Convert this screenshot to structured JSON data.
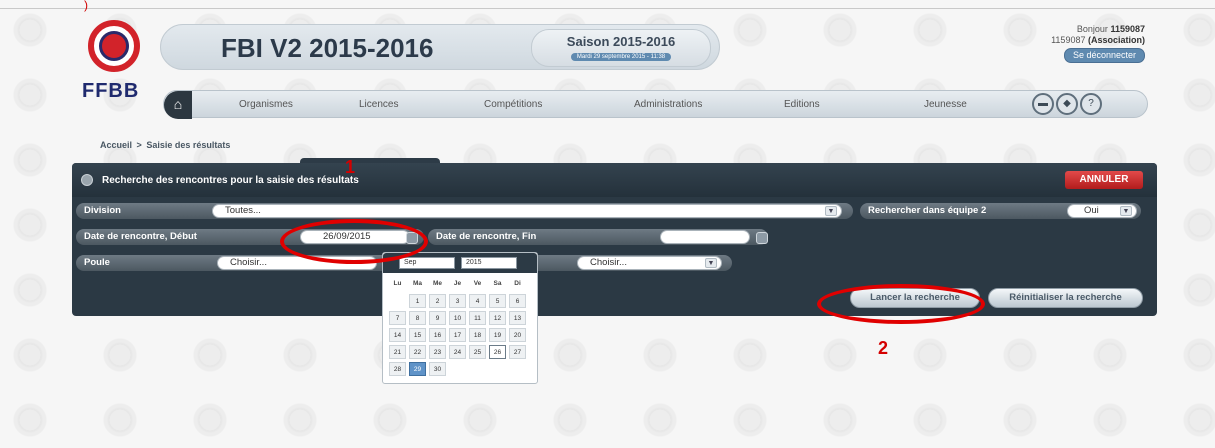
{
  "header": {
    "logo_text": "FFBB",
    "app_title": "FBI V2 2015-2016",
    "season_title": "Saison 2015-2016",
    "season_date": "Mardi 29 septembre 2015 - 11:38",
    "greeting_prefix": "Bonjour",
    "user_id": "1159087",
    "user_line_id": "1159087",
    "user_line_role": "(Association)",
    "logout_label": "Se déconnecter"
  },
  "nav": {
    "items": [
      "Organismes",
      "Licences",
      "Compétitions",
      "Administrations",
      "Editions",
      "Jeunesse"
    ],
    "icons": [
      "message-icon",
      "bookmark-icon",
      "help-icon"
    ],
    "help_glyph": "?"
  },
  "breadcrumb": {
    "home": "Accueil",
    "separator": ">",
    "current": "Saisie des résultats"
  },
  "panel": {
    "title": "Recherche des rencontres pour la saisie des résultats",
    "cancel_label": "ANNULER",
    "division_label": "Division",
    "division_value": "Toutes...",
    "search_team2_label": "Rechercher dans équipe 2",
    "search_team2_value": "Oui",
    "date_start_label": "Date de rencontre, Début",
    "date_start_value": "26/09/2015",
    "date_end_label": "Date de rencontre, Fin",
    "date_end_value": "",
    "poule_label": "Poule",
    "poule_value": "Choisir...",
    "second_select_value": "Choisir...",
    "search_button": "Lancer la recherche",
    "reset_button": "Réinitialiser la recherche"
  },
  "calendar": {
    "month": "Sep",
    "year": "2015",
    "weekdays": [
      "Lu",
      "Ma",
      "Me",
      "Je",
      "Ve",
      "Sa",
      "Di"
    ],
    "weeks": [
      [
        "",
        "1",
        "2",
        "3",
        "4",
        "5",
        "6"
      ],
      [
        "7",
        "8",
        "9",
        "10",
        "11",
        "12",
        "13"
      ],
      [
        "14",
        "15",
        "16",
        "17",
        "18",
        "19",
        "20"
      ],
      [
        "21",
        "22",
        "23",
        "24",
        "25",
        "26",
        "27"
      ],
      [
        "28",
        "29",
        "30",
        "",
        "",
        "",
        ""
      ]
    ],
    "selected_day": "29",
    "outlined_day": "26"
  },
  "annotations": {
    "one": "1",
    "two": "2"
  },
  "colors": {
    "accent": "#d2232a",
    "panel": "#2b3944",
    "selected": "#5f93c8",
    "annotation": "#e00000"
  }
}
